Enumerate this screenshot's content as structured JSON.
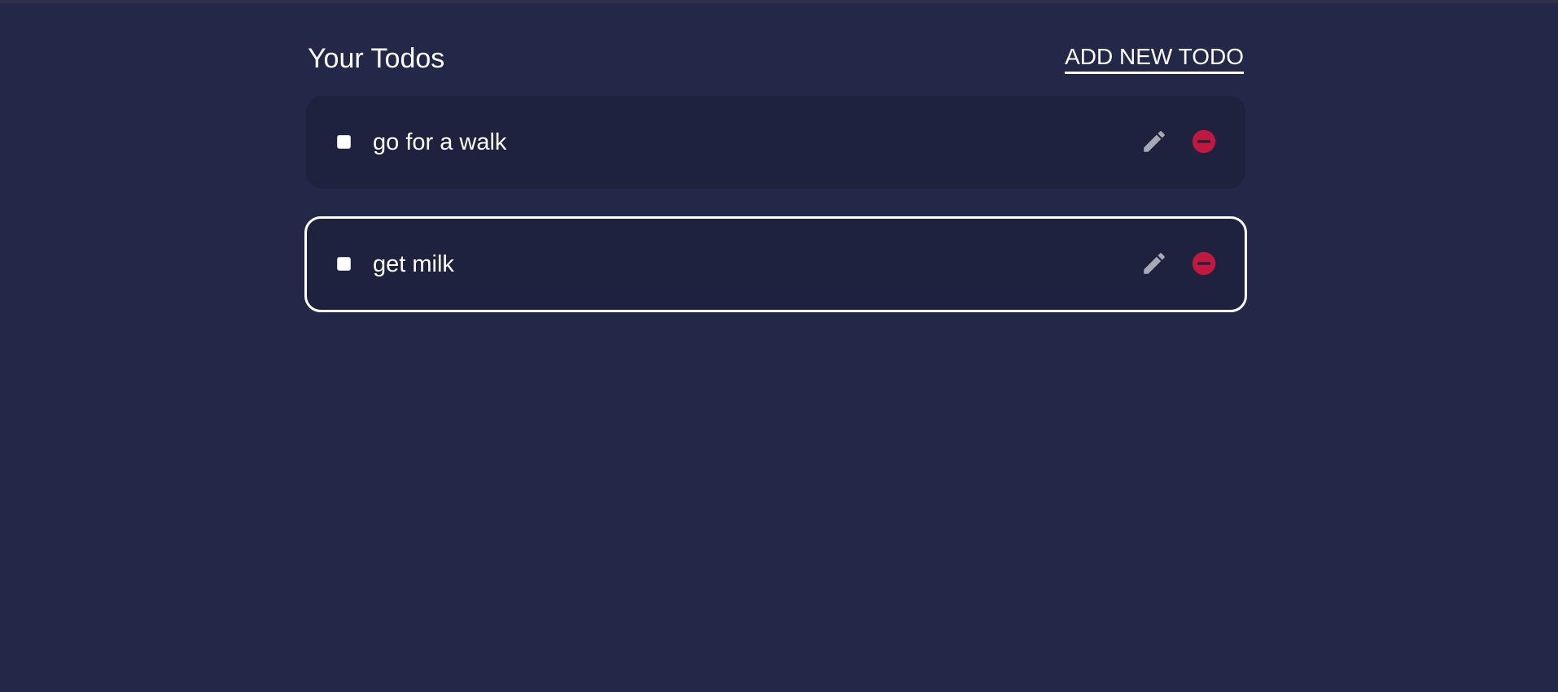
{
  "header": {
    "title": "Your Todos",
    "add_label": "ADD NEW TODO"
  },
  "todos": [
    {
      "text": "go for a walk",
      "checked": false,
      "focused": false
    },
    {
      "text": "get milk",
      "checked": false,
      "focused": true
    }
  ],
  "icons": {
    "edit": "pencil-icon",
    "delete": "minus-circle-icon"
  },
  "colors": {
    "background": "#242848",
    "card": "#1f223e",
    "edit_icon": "#a7a9b4",
    "delete_icon": "#c0183f",
    "text": "#ffffff"
  }
}
